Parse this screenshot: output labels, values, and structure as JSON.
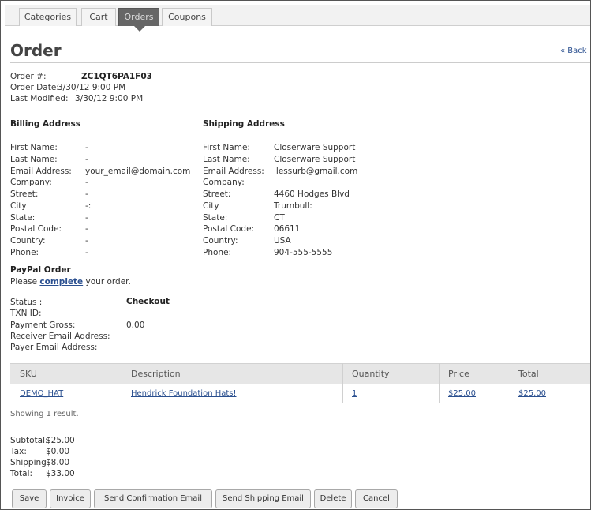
{
  "tabs": [
    {
      "label": "Categories"
    },
    {
      "label": "Cart"
    },
    {
      "label": "Orders"
    },
    {
      "label": "Coupons"
    }
  ],
  "page": {
    "title": "Order",
    "back_link": "« Back"
  },
  "order": {
    "number_label": "Order #:",
    "number": "ZC1QT6PA1F03",
    "date_label": "Order Date:",
    "date": "3/30/12 9:00 PM",
    "modified_label": "Last Modified:",
    "modified": "3/30/12 9:00 PM"
  },
  "billing": {
    "heading": "Billing Address",
    "fields": [
      {
        "label": "First Name:",
        "value": "-"
      },
      {
        "label": "Last Name:",
        "value": "-"
      },
      {
        "label": "Email Address:",
        "value": "your_email@domain.com"
      },
      {
        "label": "Company:",
        "value": "-"
      },
      {
        "label": "Street:",
        "value": "-"
      },
      {
        "label": "City",
        "value": "-:"
      },
      {
        "label": "State:",
        "value": "-"
      },
      {
        "label": "Postal Code:",
        "value": "-"
      },
      {
        "label": "Country:",
        "value": "-"
      },
      {
        "label": "Phone:",
        "value": "-"
      }
    ]
  },
  "shipping": {
    "heading": "Shipping Address",
    "fields": [
      {
        "label": "First Name:",
        "value": "Closerware Support"
      },
      {
        "label": "Last Name:",
        "value": "Closerware Support"
      },
      {
        "label": "Email Address:",
        "value": "llessurb@gmail.com"
      },
      {
        "label": "Company:",
        "value": ""
      },
      {
        "label": "Street:",
        "value": "4460 Hodges Blvd"
      },
      {
        "label": "City",
        "value": "Trumbull:"
      },
      {
        "label": "State:",
        "value": "CT"
      },
      {
        "label": "Postal Code:",
        "value": "06611"
      },
      {
        "label": "Country:",
        "value": "USA"
      },
      {
        "label": "Phone:",
        "value": "904-555-5555"
      }
    ]
  },
  "paypal": {
    "heading": "PayPal Order",
    "text_before": "Please ",
    "link": "complete",
    "text_after": " your order.",
    "status_label": "Status :",
    "status": "Checkout",
    "txn_label": "TXN ID:",
    "txn": "",
    "gross_label": "Payment Gross:",
    "gross": "0.00",
    "receiver_label": "Receiver Email Address:",
    "receiver": "",
    "payer_label": "Payer Email Address:",
    "payer": ""
  },
  "table": {
    "columns": [
      "SKU",
      "Description",
      "Quantity",
      "Price",
      "Total"
    ],
    "rows": [
      {
        "sku": "DEMO_HAT",
        "description": "Hendrick Foundation Hats!",
        "quantity": "1",
        "price": "$25.00",
        "total": "$25.00"
      }
    ],
    "showing": "Showing 1 result."
  },
  "totals": {
    "subtotal_label": "Subtotal:",
    "subtotal": "$25.00",
    "tax_label": "Tax:",
    "tax": "$0.00",
    "shipping_label": "Shipping",
    "shipping": "$8.00",
    "total_label": "Total:",
    "total": "$33.00"
  },
  "buttons": {
    "save": "Save",
    "invoice": "Invoice",
    "confirm": "Send Confirmation Email",
    "ship": "Send Shipping Email",
    "delete": "Delete",
    "cancel": "Cancel"
  }
}
